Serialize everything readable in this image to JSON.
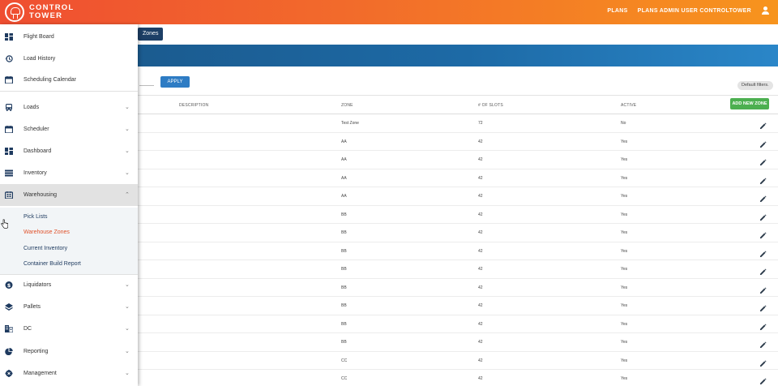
{
  "app": {
    "logo_line1": "CONTROL",
    "logo_line2": "TOWER",
    "header_left": "PLANS",
    "header_right": "PLANS ADMIN USER CONTROLTOWER"
  },
  "breadcrumb": {
    "label": "Zones"
  },
  "filters": {
    "apply_label": "APPLY",
    "default_filters_label": "Default filters."
  },
  "table": {
    "headers": {
      "description": "DESCRIPTION",
      "zone": "ZONE",
      "slots": "# OF SLOTS",
      "active": "ACTIVE"
    },
    "add_button_label": "ADD NEW ZONE",
    "rows": [
      {
        "zone": "Test Zone",
        "slots": "72",
        "active": "No"
      },
      {
        "zone": "AA",
        "slots": "42",
        "active": "Yes"
      },
      {
        "zone": "AA",
        "slots": "42",
        "active": "Yes"
      },
      {
        "zone": "AA",
        "slots": "42",
        "active": "Yes"
      },
      {
        "zone": "AA",
        "slots": "42",
        "active": "Yes"
      },
      {
        "zone": "BB",
        "slots": "42",
        "active": "Yes"
      },
      {
        "zone": "BB",
        "slots": "42",
        "active": "Yes"
      },
      {
        "zone": "BB",
        "slots": "42",
        "active": "Yes"
      },
      {
        "zone": "BB",
        "slots": "42",
        "active": "Yes"
      },
      {
        "zone": "BB",
        "slots": "42",
        "active": "Yes"
      },
      {
        "zone": "BB",
        "slots": "42",
        "active": "Yes"
      },
      {
        "zone": "BB",
        "slots": "42",
        "active": "Yes"
      },
      {
        "zone": "BB",
        "slots": "42",
        "active": "Yes"
      },
      {
        "zone": "CC",
        "slots": "42",
        "active": "Yes"
      },
      {
        "zone": "CC",
        "slots": "42",
        "active": "Yes"
      }
    ]
  },
  "sidebar": {
    "items": [
      {
        "label": "Flight Board",
        "icon": "dashboard-icon"
      },
      {
        "label": "Load History",
        "icon": "history-icon"
      },
      {
        "label": "Scheduling Calendar",
        "icon": "calendar-icon"
      },
      {
        "label": "Loads",
        "icon": "bus-icon"
      },
      {
        "label": "Scheduler",
        "icon": "calendar-icon"
      },
      {
        "label": "Dashboard",
        "icon": "dashboard-icon"
      },
      {
        "label": "Inventory",
        "icon": "list-icon"
      },
      {
        "label": "Warehousing",
        "icon": "warehouse-icon"
      },
      {
        "label": "Liquidators",
        "icon": "dollar-icon"
      },
      {
        "label": "Pallets",
        "icon": "layers-icon"
      },
      {
        "label": "DC",
        "icon": "building-icon"
      },
      {
        "label": "Reporting",
        "icon": "pie-chart-icon"
      },
      {
        "label": "Management",
        "icon": "gear-icon"
      }
    ],
    "submenu": [
      {
        "label": "Pick Lists"
      },
      {
        "label": "Warehouse Zones"
      },
      {
        "label": "Current Inventory"
      },
      {
        "label": "Container Build Report"
      }
    ]
  }
}
